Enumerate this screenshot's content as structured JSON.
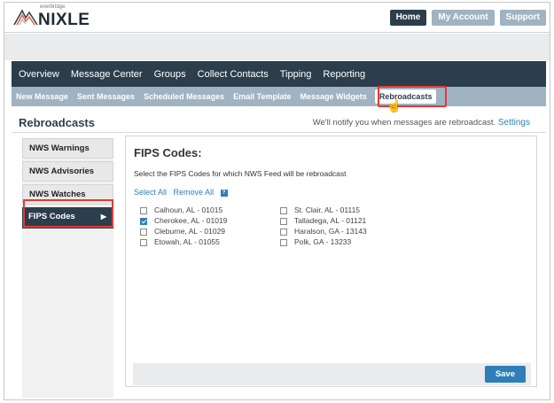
{
  "brand": {
    "small": "everbridge",
    "name": "NIXLE"
  },
  "top_buttons": [
    {
      "label": "Home",
      "style": "home"
    },
    {
      "label": "My Account",
      "style": "other"
    },
    {
      "label": "Support",
      "style": "other"
    }
  ],
  "main_nav": [
    "Overview",
    "Message Center",
    "Groups",
    "Collect Contacts",
    "Tipping",
    "Reporting"
  ],
  "main_nav_active": "Message Center",
  "sub_nav": [
    "New Message",
    "Sent Messages",
    "Scheduled Messages",
    "Email Template",
    "Message Widgets",
    "Rebroadcasts"
  ],
  "sub_nav_active": "Rebroadcasts",
  "page": {
    "title": "Rebroadcasts",
    "notify_text": "We'll notify you when messages are rebroadcast.",
    "settings_link": "Settings"
  },
  "side_menu": [
    {
      "label": "NWS Warnings",
      "active": false
    },
    {
      "label": "NWS Advisories",
      "active": false
    },
    {
      "label": "NWS Watches",
      "active": false
    },
    {
      "label": "FIPS Codes",
      "active": true
    }
  ],
  "panel": {
    "title": "FIPS Codes:",
    "description": "Select the FIPS Codes for which NWS Feed will be rebroadcast",
    "select_all": "Select All",
    "remove_all": "Remove All",
    "help_icon": "?",
    "save_label": "Save"
  },
  "fips_col1": [
    {
      "label": "Calhoun, AL - 01015",
      "checked": false
    },
    {
      "label": "Cherokee, AL - 01019",
      "checked": true
    },
    {
      "label": "Cleburne, AL - 01029",
      "checked": false
    },
    {
      "label": "Etowah, AL - 01055",
      "checked": false
    }
  ],
  "fips_col2": [
    {
      "label": "St. Clair, AL - 01115",
      "checked": false
    },
    {
      "label": "Talladega, AL - 01121",
      "checked": false
    },
    {
      "label": "Haralson, GA - 13143",
      "checked": false
    },
    {
      "label": "Polk, GA - 13233",
      "checked": false
    }
  ],
  "colors": {
    "dark_nav": "#2c3e4c",
    "sub_nav": "#9fb3c2",
    "link": "#2e7fb8",
    "highlight": "#e53935"
  }
}
